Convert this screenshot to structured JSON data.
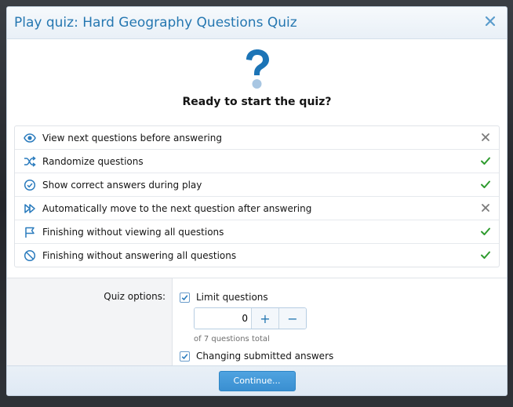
{
  "dialog": {
    "title": "Play quiz: Hard Geography Questions Quiz",
    "close_label": "×"
  },
  "hero": {
    "icon": "question-mark-icon",
    "title": "Ready to start the quiz?"
  },
  "rules": [
    {
      "icon": "eye-icon",
      "label": "View next questions before answering",
      "status": "disallowed"
    },
    {
      "icon": "shuffle-icon",
      "label": "Randomize questions",
      "status": "allowed"
    },
    {
      "icon": "check-circle-icon",
      "label": "Show correct answers during play",
      "status": "allowed"
    },
    {
      "icon": "fast-forward-icon",
      "label": "Automatically move to the next question after answering",
      "status": "disallowed"
    },
    {
      "icon": "flag-icon",
      "label": "Finishing without viewing all questions",
      "status": "allowed"
    },
    {
      "icon": "prohibited-icon",
      "label": "Finishing without answering all questions",
      "status": "allowed"
    }
  ],
  "options": {
    "label": "Quiz options:",
    "limit_questions": {
      "label": "Limit questions",
      "checked": true,
      "value": "0",
      "hint": "of 7 questions total"
    },
    "changing_answers": {
      "label": "Changing submitted answers",
      "checked": true
    }
  },
  "footer": {
    "continue_label": "Continue..."
  },
  "colors": {
    "accent": "#2577b1",
    "allowed": "#2e9b2e",
    "disallowed": "#7a7a7a"
  }
}
